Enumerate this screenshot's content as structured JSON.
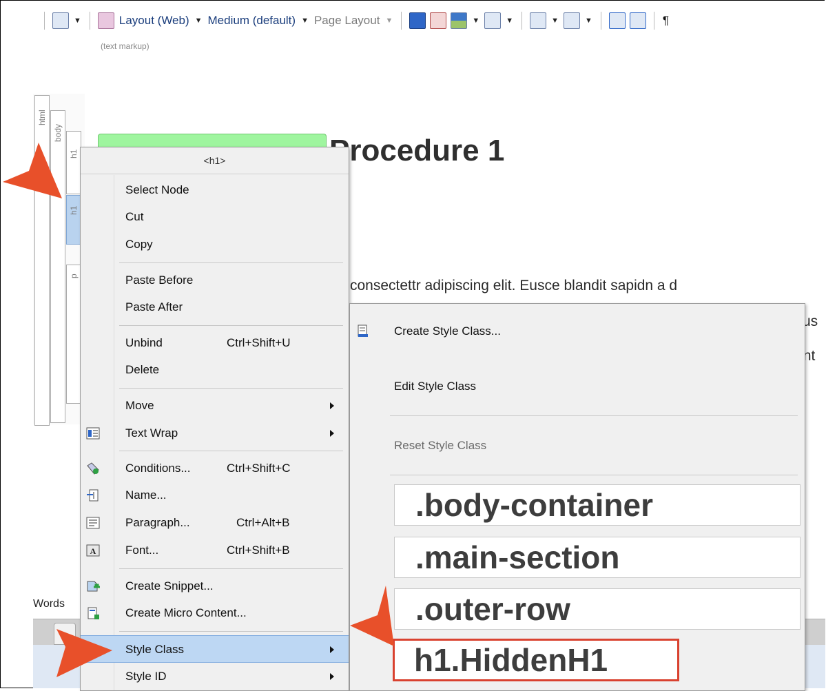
{
  "toolbar": {
    "layout": "Layout (Web)",
    "medium": "Medium (default)",
    "page_layout": "Page Layout",
    "pilcrow": "¶",
    "caption": "(text markup)"
  },
  "structure_bar": {
    "html": "html",
    "body": "body",
    "h1_top": "h1",
    "h1": "h1",
    "p": "p"
  },
  "editor": {
    "heading": "Procedure 1",
    "para_line1": "consectettr adipiscing elit. Eusce blandit sapidn a d",
    "para_line2_end": "us",
    "para_line3_end": "Int",
    "status_words": "Words"
  },
  "context_menu": {
    "header": "<h1>",
    "items": [
      {
        "label": "Select Node",
        "shortcut": "",
        "submenu": false
      },
      {
        "label": "Cut",
        "shortcut": "",
        "submenu": false
      },
      {
        "label": "Copy",
        "shortcut": "",
        "submenu": false
      },
      {
        "label": "Paste Before",
        "shortcut": "",
        "submenu": false
      },
      {
        "label": "Paste After",
        "shortcut": "",
        "submenu": false
      },
      {
        "label": "Unbind",
        "shortcut": "Ctrl+Shift+U",
        "submenu": false
      },
      {
        "label": "Delete",
        "shortcut": "",
        "submenu": false
      },
      {
        "label": "Move",
        "shortcut": "",
        "submenu": true
      },
      {
        "label": "Text Wrap",
        "shortcut": "",
        "submenu": true
      },
      {
        "label": "Conditions...",
        "shortcut": "Ctrl+Shift+C",
        "submenu": false
      },
      {
        "label": "Name...",
        "shortcut": "",
        "submenu": false
      },
      {
        "label": "Paragraph...",
        "shortcut": "Ctrl+Alt+B",
        "submenu": false
      },
      {
        "label": "Font...",
        "shortcut": "Ctrl+Shift+B",
        "submenu": false
      },
      {
        "label": "Create Snippet...",
        "shortcut": "",
        "submenu": false
      },
      {
        "label": "Create Micro Content...",
        "shortcut": "",
        "submenu": false
      },
      {
        "label": "Style Class",
        "shortcut": "",
        "submenu": true
      },
      {
        "label": "Style ID",
        "shortcut": "",
        "submenu": true
      }
    ]
  },
  "style_class_submenu": {
    "create": "Create Style Class...",
    "edit": "Edit Style Class",
    "reset": "Reset Style Class",
    "classes": [
      ".body-container",
      ".main-section",
      ".outer-row",
      "h1.HiddenH1"
    ]
  },
  "colors": {
    "callout": "#e8502a",
    "highlight": "#bdd7f3",
    "tag_green": "#9ff59f",
    "active_border": "#d9412f"
  }
}
